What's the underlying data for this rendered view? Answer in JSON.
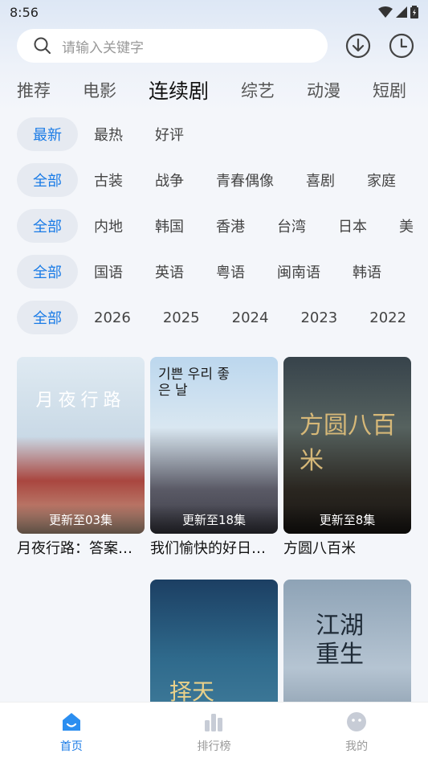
{
  "status": {
    "time": "8:56"
  },
  "search": {
    "placeholder": "请输入关键字"
  },
  "categories": [
    "推荐",
    "电影",
    "连续剧",
    "综艺",
    "动漫",
    "短剧"
  ],
  "filters": {
    "sort": [
      "最新",
      "最热",
      "好评"
    ],
    "genre": [
      "全部",
      "古装",
      "战争",
      "青春偶像",
      "喜剧",
      "家庭"
    ],
    "region": [
      "全部",
      "内地",
      "韩国",
      "香港",
      "台湾",
      "日本",
      "美"
    ],
    "language": [
      "全部",
      "国语",
      "英语",
      "粤语",
      "闽南语",
      "韩语"
    ],
    "year": [
      "全部",
      "2026",
      "2025",
      "2024",
      "2023",
      "2022"
    ]
  },
  "shows": [
    {
      "title": "月夜行路：答案…",
      "badge": "更新至03集",
      "poster_text": "月夜行路"
    },
    {
      "title": "我们愉快的好日…",
      "badge": "更新至18集",
      "poster_text": "기쁜 우리 좋은 날"
    },
    {
      "title": "方圆八百米",
      "badge": "更新至8集",
      "poster_text": "方圆八百米"
    },
    {
      "title": "",
      "badge": "",
      "poster_text": "择天"
    },
    {
      "title": "",
      "badge": "",
      "poster_text": "江湖重生"
    }
  ],
  "bottom_nav": [
    {
      "label": "首页",
      "icon": "home-icon"
    },
    {
      "label": "排行榜",
      "icon": "bar-chart-icon"
    },
    {
      "label": "我的",
      "icon": "smiley-icon"
    }
  ],
  "colors": {
    "accent": "#1a7be6",
    "chip_bg": "#e6eaf1",
    "background": "#f4f6fa"
  }
}
